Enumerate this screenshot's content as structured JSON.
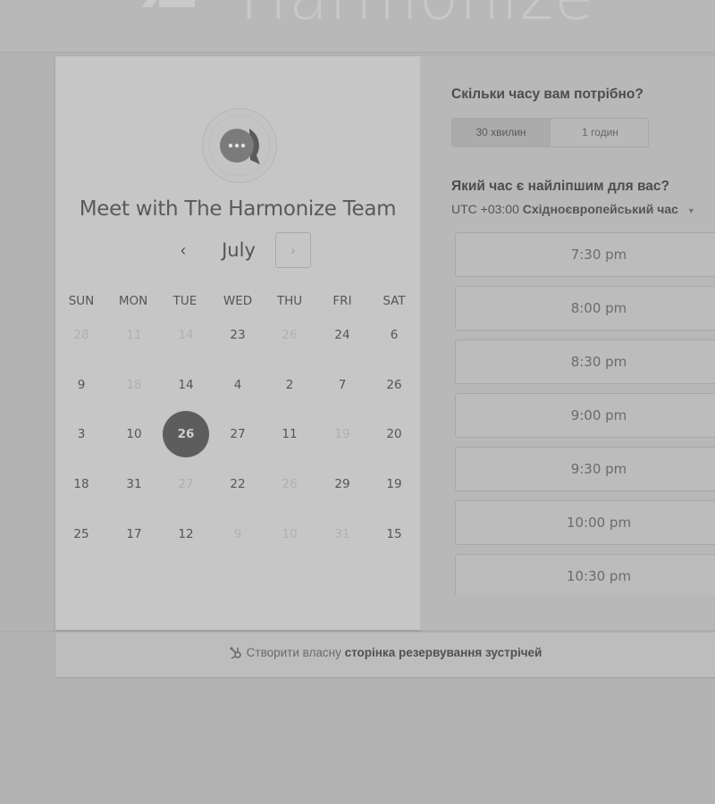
{
  "brand": {
    "name": "Harmonize"
  },
  "booking": {
    "title": "Meet with The Harmonize Team",
    "avatar_icon": "chat-bubble-icon",
    "calendar": {
      "month": "July",
      "prev_label": "‹",
      "next_label": "›",
      "weekdays": [
        "SUN",
        "MON",
        "TUE",
        "WED",
        "THU",
        "FRI",
        "SAT"
      ],
      "weeks": [
        [
          {
            "d": "28",
            "dim": true
          },
          {
            "d": "11",
            "dim": true
          },
          {
            "d": "14",
            "dim": true
          },
          {
            "d": "23",
            "dim": false
          },
          {
            "d": "26",
            "dim": true
          },
          {
            "d": "24",
            "dim": false
          },
          {
            "d": "6",
            "dim": false
          }
        ],
        [
          {
            "d": "9",
            "dim": false
          },
          {
            "d": "18",
            "dim": true
          },
          {
            "d": "14",
            "dim": false
          },
          {
            "d": "4",
            "dim": false
          },
          {
            "d": "2",
            "dim": false
          },
          {
            "d": "7",
            "dim": false
          },
          {
            "d": "26",
            "dim": false
          }
        ],
        [
          {
            "d": "3",
            "dim": false
          },
          {
            "d": "10",
            "dim": false
          },
          {
            "d": "26",
            "dim": false,
            "selected": true
          },
          {
            "d": "27",
            "dim": false
          },
          {
            "d": "11",
            "dim": false
          },
          {
            "d": "19",
            "dim": true
          },
          {
            "d": "20",
            "dim": false
          }
        ],
        [
          {
            "d": "18",
            "dim": false
          },
          {
            "d": "31",
            "dim": false
          },
          {
            "d": "27",
            "dim": true
          },
          {
            "d": "22",
            "dim": false
          },
          {
            "d": "26",
            "dim": true
          },
          {
            "d": "29",
            "dim": false
          },
          {
            "d": "19",
            "dim": false
          }
        ],
        [
          {
            "d": "25",
            "dim": false
          },
          {
            "d": "17",
            "dim": false
          },
          {
            "d": "12",
            "dim": false
          },
          {
            "d": "9",
            "dim": true
          },
          {
            "d": "10",
            "dim": true
          },
          {
            "d": "31",
            "dim": true
          },
          {
            "d": "15",
            "dim": false
          }
        ]
      ]
    }
  },
  "duration": {
    "question": "Скільки часу вам потрібно?",
    "options": [
      "30 хвилин",
      "1 годин"
    ],
    "selected": "30 хвилин"
  },
  "time": {
    "question": "Який час є найліпшим для вас?",
    "timezone_offset": "UTC +03:00",
    "timezone_name": "Східноєвропейський час",
    "slots": [
      "7:30 pm",
      "8:00 pm",
      "8:30 pm",
      "9:00 pm",
      "9:30 pm",
      "10:00 pm",
      "10:30 pm"
    ]
  },
  "footer": {
    "prefix": "Створити власну",
    "bold": "сторінка резервування зустрічей"
  },
  "colors": {
    "selected_day": "#5d5d5d",
    "panel": "#c6c6c6"
  }
}
